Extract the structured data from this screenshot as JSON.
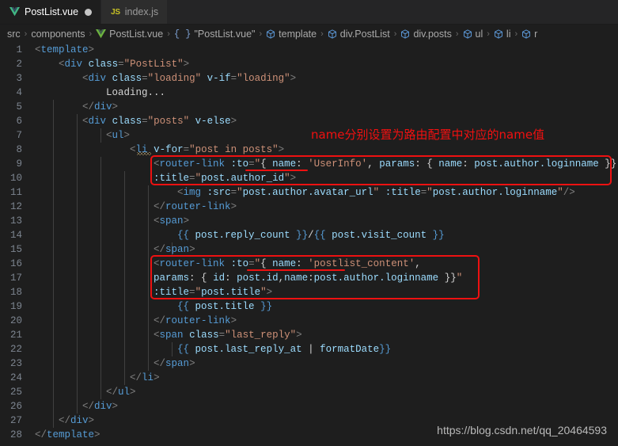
{
  "tabs": [
    {
      "label": "PostList.vue",
      "icon": "vue-icon",
      "active": true,
      "modified": true
    },
    {
      "label": "index.js",
      "icon": "js-icon",
      "active": false,
      "modified": false
    }
  ],
  "breadcrumb": [
    {
      "label": "src",
      "icon": ""
    },
    {
      "label": "components",
      "icon": ""
    },
    {
      "label": "PostList.vue",
      "icon": "vue-icon"
    },
    {
      "label": "\"PostList.vue\"",
      "icon": "braces-icon"
    },
    {
      "label": "template",
      "icon": "cube-icon"
    },
    {
      "label": "div.PostList",
      "icon": "cube-icon"
    },
    {
      "label": "div.posts",
      "icon": "cube-icon"
    },
    {
      "label": "ul",
      "icon": "cube-icon"
    },
    {
      "label": "li",
      "icon": "cube-icon"
    },
    {
      "label": "r",
      "icon": "cube-icon"
    }
  ],
  "breadcrumb_separator": "›",
  "editor": {
    "language": "vue",
    "line_numbers": [
      1,
      2,
      3,
      4,
      5,
      6,
      7,
      8,
      9,
      10,
      11,
      12,
      13,
      14,
      15,
      16,
      17,
      18,
      19,
      20,
      21,
      22,
      23,
      24,
      25,
      26,
      27,
      28
    ],
    "lines": [
      "<template>",
      "    <div class=\"PostList\">",
      "        <div class=\"loading\" v-if=\"loading\">",
      "            Loading...",
      "        </div>",
      "        <div class=\"posts\" v-else>",
      "            <ul>",
      "                <li v-for=\"post in posts\">",
      "                    <router-link :to=\"{ name: 'UserInfo', params: { name: post.author.loginname }}\"",
      "                    :title=\"post.author_id\">",
      "                        <img :src=\"post.author.avatar_url\" :title=\"post.author.loginname\"/>",
      "                    </router-link>",
      "                    <span>",
      "                        {{ post.reply_count }}/{{ post.visit_count }}",
      "                    </span>",
      "                    <router-link :to=\"{ name: 'postlist_content',",
      "                    params: { id: post.id,name:post.author.loginname }}\"",
      "                    :title=\"post.title\">",
      "                        {{ post.title }}",
      "                    </router-link>",
      "                    <span class=\"last_reply\">",
      "                        {{ post.last_reply_at | formatDate}}",
      "                    </span>",
      "                </li>",
      "            </ul>",
      "        </div>",
      "    </div>",
      "</template>"
    ]
  },
  "annotations": {
    "chinese_note": "name分别设置为路由配置中对应的name值",
    "highlight_color": "#ee1111",
    "box_1_lines": "9-10",
    "box_2_lines": "16-18",
    "underline_1_text": "name:",
    "underline_2_text": "'postlist_content'"
  },
  "watermark": "https://blog.csdn.net/qq_20464593",
  "colors": {
    "background": "#1e1e1e",
    "tabbar": "#252526",
    "tab_inactive": "#2d2d2d",
    "tag": "#569cd6",
    "attribute": "#9cdcfe",
    "string": "#ce9178",
    "linenum": "#7d8590",
    "annotation": "#ee1111"
  }
}
